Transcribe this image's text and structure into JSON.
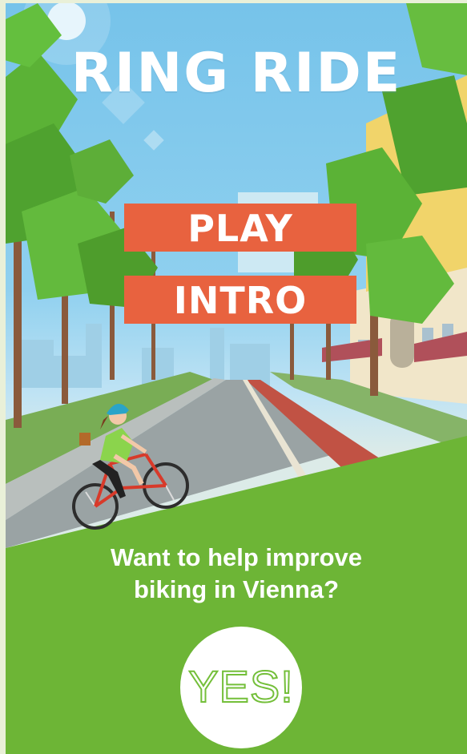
{
  "game": {
    "title": "RING RIDE",
    "menu": {
      "play_label": "PLAY",
      "intro_label": "INTRO"
    },
    "survey": {
      "question_line1": "Want to help improve",
      "question_line2": "biking in Vienna?",
      "yes_label": "YES!"
    }
  },
  "colors": {
    "sky": "#8fd0ef",
    "button_orange": "#e8623f",
    "grass_green": "#6db536",
    "tree_green": "#5cb236",
    "bike_red": "#d83a2a",
    "white": "#ffffff"
  }
}
